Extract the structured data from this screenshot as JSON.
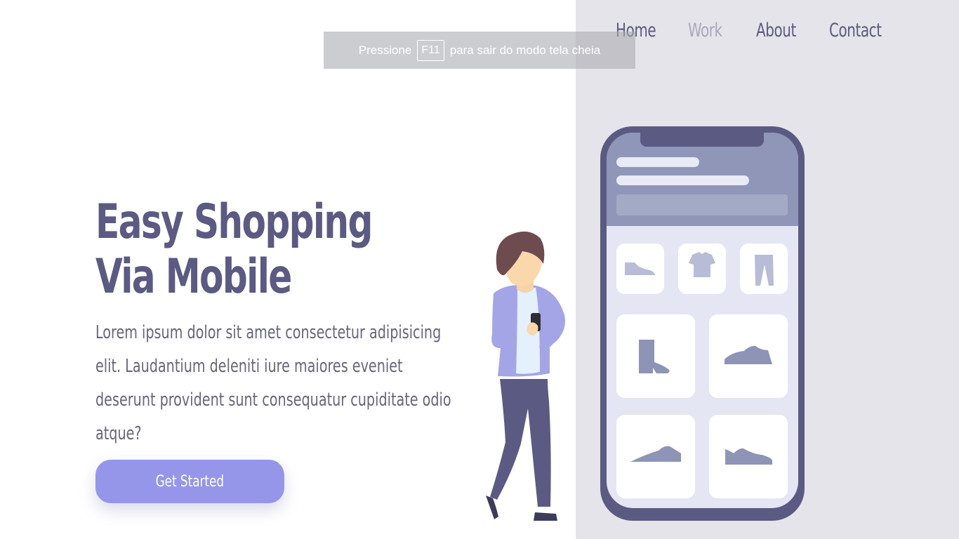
{
  "nav": {
    "items": [
      {
        "label": "Home"
      },
      {
        "label": "Work"
      },
      {
        "label": "About"
      },
      {
        "label": "Contact"
      }
    ]
  },
  "fullscreen_notice": {
    "before": "Pressione",
    "key": "F11",
    "after": "para sair do modo tela cheia"
  },
  "hero": {
    "title_line1": "Easy Shopping",
    "title_line2": "Via Mobile",
    "description": "Lorem ipsum dolor sit amet consectetur adipisicing elit. Laudantium deleniti iure maiores eveniet deserunt provident sunt consequatur cupiditate odio atque?",
    "cta_label": "Get Started"
  },
  "colors": {
    "accent": "#9596ea",
    "heading": "#5b5a82",
    "panel": "#e5e4ea"
  }
}
